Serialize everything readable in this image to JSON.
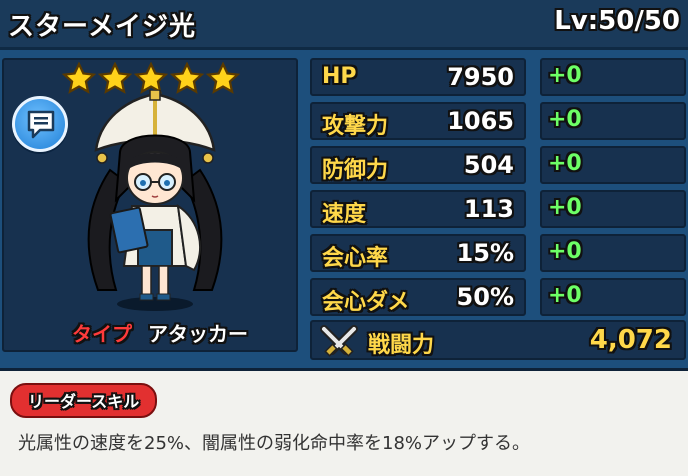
{
  "header": {
    "title": "スターメイジ光",
    "level": "Lv:50/50"
  },
  "character": {
    "stars": 5,
    "star_icon": "star-icon",
    "chat_icon": "speech-bubble-icon",
    "type_label": "タイプ",
    "type_value": "アタッカー"
  },
  "stats": [
    {
      "label": "HP",
      "value": "7950",
      "bonus": "+0"
    },
    {
      "label": "攻撃力",
      "value": "1065",
      "bonus": "+0"
    },
    {
      "label": "防御力",
      "value": "504",
      "bonus": "+0"
    },
    {
      "label": "速度",
      "value": "113",
      "bonus": "+0"
    },
    {
      "label": "会心率",
      "value": "15%",
      "bonus": "+0"
    },
    {
      "label": "会心ダメ",
      "value": "50%",
      "bonus": "+0"
    }
  ],
  "power": {
    "label": "戦闘力",
    "value": "4,072",
    "icon": "crossed-swords-icon"
  },
  "leader_skill": {
    "tag": "リーダースキル",
    "text": "光属性の速度を25%、闇属性の弱化命中率を18%アップする。"
  },
  "colors": {
    "stat_label": "#ffd84a",
    "bonus": "#6dff66",
    "type_label": "#ff3b3b",
    "skill_tag": "#e23030"
  }
}
